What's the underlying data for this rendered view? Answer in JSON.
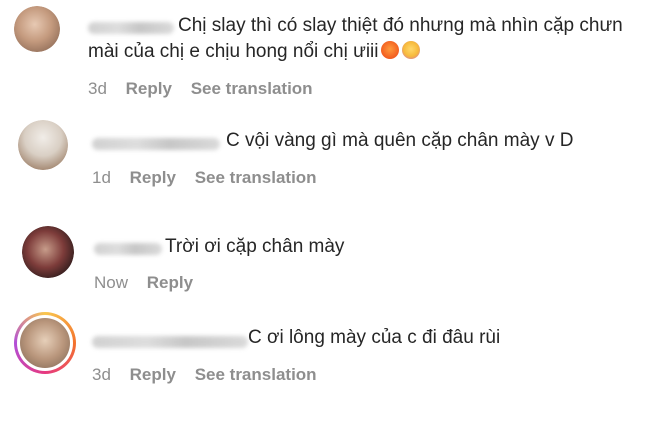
{
  "comments": [
    {
      "text_line1": "Chị slay thì có slay thiệt đó nhưng mà nhìn cặp chưn",
      "text_line2": "mài của chị e chịu hong nổi chị ưiii",
      "time": "3d",
      "reply": "Reply",
      "translation": "See translation",
      "emojis": [
        "angry-face-emoji",
        "laughing-face-emoji"
      ]
    },
    {
      "text": "C vội vàng gì mà quên cặp chân mày v D",
      "time": "1d",
      "reply": "Reply",
      "translation": "See translation"
    },
    {
      "text": "Trời ơi cặp chân mày",
      "time": "Now",
      "reply": "Reply"
    },
    {
      "text": "C ơi lông mày của c đi đâu rùi",
      "time": "3d",
      "reply": "Reply",
      "translation": "See translation"
    }
  ],
  "colors": {
    "text": "#262626",
    "meta": "#8e8e8e",
    "background": "#ffffff"
  }
}
